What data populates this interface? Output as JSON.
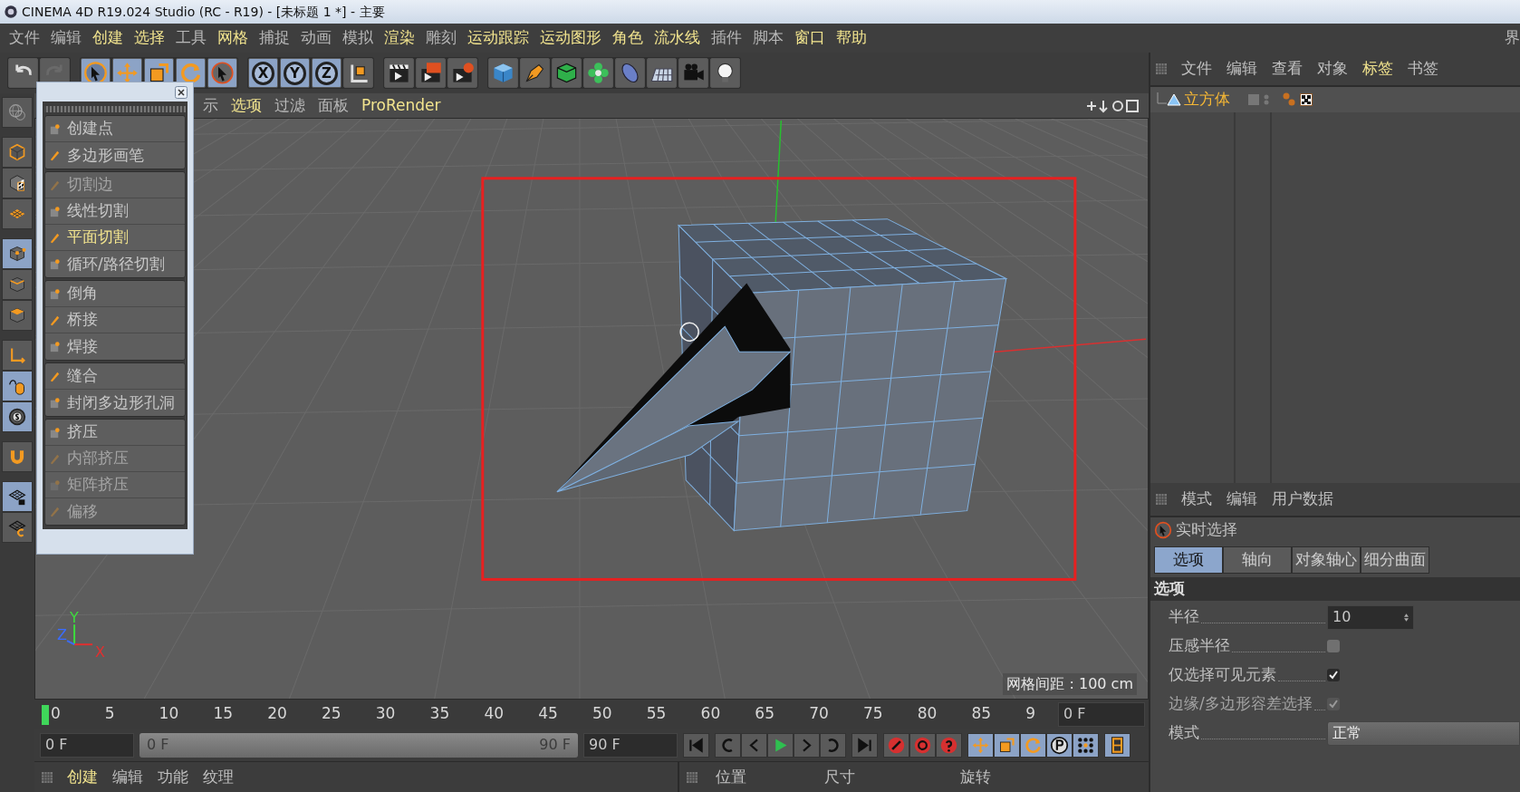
{
  "window": {
    "title": "CINEMA 4D R19.024 Studio (RC - R19) - [未标题 1 *] - 主要"
  },
  "menu": [
    {
      "label": "文件",
      "highlighted": false
    },
    {
      "label": "编辑",
      "highlighted": false
    },
    {
      "label": "创建",
      "highlighted": true
    },
    {
      "label": "选择",
      "highlighted": true
    },
    {
      "label": "工具",
      "highlighted": false
    },
    {
      "label": "网格",
      "highlighted": true
    },
    {
      "label": "捕捉",
      "highlighted": false
    },
    {
      "label": "动画",
      "highlighted": false
    },
    {
      "label": "模拟",
      "highlighted": false
    },
    {
      "label": "渲染",
      "highlighted": true
    },
    {
      "label": "雕刻",
      "highlighted": false
    },
    {
      "label": "运动跟踪",
      "highlighted": true
    },
    {
      "label": "运动图形",
      "highlighted": true
    },
    {
      "label": "角色",
      "highlighted": true
    },
    {
      "label": "流水线",
      "highlighted": true
    },
    {
      "label": "插件",
      "highlighted": false
    },
    {
      "label": "脚本",
      "highlighted": false
    },
    {
      "label": "窗口",
      "highlighted": true
    },
    {
      "label": "帮助",
      "highlighted": true
    }
  ],
  "menu_edge": "界",
  "toolbar": {
    "axis_locks": [
      "X",
      "Y",
      "Z"
    ]
  },
  "left_tools": [
    {
      "kind": "globe",
      "selected": false
    },
    {
      "kind": "cube",
      "selected": false
    },
    {
      "kind": "checker",
      "selected": false
    },
    {
      "kind": "grid",
      "selected": false
    },
    {
      "kind": "points",
      "selected": true
    },
    {
      "kind": "edges",
      "selected": false
    },
    {
      "kind": "polygons",
      "selected": false
    },
    {
      "kind": "axis",
      "selected": false
    },
    {
      "kind": "mouse",
      "selected": true
    },
    {
      "kind": "snap",
      "selected": true
    },
    {
      "kind": "magnet",
      "selected": false
    },
    {
      "kind": "gridlock",
      "selected": true
    },
    {
      "kind": "gridrotate",
      "selected": false
    }
  ],
  "viewport": {
    "menu": [
      {
        "label": "示",
        "highlighted": false
      },
      {
        "label": "选项",
        "highlighted": true
      },
      {
        "label": "过滤",
        "highlighted": false
      },
      {
        "label": "面板",
        "highlighted": false
      },
      {
        "label": "ProRender",
        "highlighted": true
      }
    ],
    "axes": [
      {
        "label": "Z",
        "color": "#3a6cff"
      },
      {
        "label": "Y",
        "color": "#3ddc3d"
      },
      {
        "label": "X",
        "color": "#e03030"
      }
    ],
    "grid_spacing": "网格间距 : 100 cm"
  },
  "tool_palette": {
    "groups": [
      {
        "items": [
          {
            "label": "创建点",
            "disabled": false,
            "highlighted": false
          },
          {
            "label": "多边形画笔",
            "disabled": false,
            "highlighted": false
          }
        ]
      },
      {
        "items": [
          {
            "label": "切割边",
            "disabled": true,
            "highlighted": false
          },
          {
            "label": "线性切割",
            "disabled": false,
            "highlighted": false
          },
          {
            "label": "平面切割",
            "disabled": false,
            "highlighted": true
          },
          {
            "label": "循环/路径切割",
            "disabled": false,
            "highlighted": false
          }
        ]
      },
      {
        "items": [
          {
            "label": "倒角",
            "disabled": false,
            "highlighted": false
          },
          {
            "label": "桥接",
            "disabled": false,
            "highlighted": false
          },
          {
            "label": "焊接",
            "disabled": false,
            "highlighted": false
          }
        ]
      },
      {
        "items": [
          {
            "label": "缝合",
            "disabled": false,
            "highlighted": false
          },
          {
            "label": "封闭多边形孔洞",
            "disabled": false,
            "highlighted": false
          }
        ]
      },
      {
        "items": [
          {
            "label": "挤压",
            "disabled": false,
            "highlighted": false
          },
          {
            "label": "内部挤压",
            "disabled": true,
            "highlighted": false
          },
          {
            "label": "矩阵挤压",
            "disabled": true,
            "highlighted": false
          },
          {
            "label": "偏移",
            "disabled": true,
            "highlighted": false
          }
        ]
      }
    ]
  },
  "object_manager": {
    "menu": [
      {
        "label": "文件",
        "highlighted": false
      },
      {
        "label": "编辑",
        "highlighted": false
      },
      {
        "label": "查看",
        "highlighted": false
      },
      {
        "label": "对象",
        "highlighted": false
      },
      {
        "label": "标签",
        "highlighted": true
      },
      {
        "label": "书签",
        "highlighted": false
      }
    ],
    "objects": [
      {
        "name": "立方体",
        "selected": true
      }
    ]
  },
  "attribute_manager": {
    "menu": [
      "模式",
      "编辑",
      "用户数据"
    ],
    "tool": "实时选择",
    "tabs": [
      {
        "label": "选项",
        "selected": true
      },
      {
        "label": "轴向",
        "selected": false
      },
      {
        "label": "对象轴心",
        "selected": false
      },
      {
        "label": "细分曲面",
        "selected": false
      }
    ],
    "section": "选项",
    "fields": [
      {
        "kind": "number",
        "label": "半径",
        "value": "10"
      },
      {
        "kind": "checkbox",
        "label": "压感半径",
        "checked": false,
        "disabled": false
      },
      {
        "kind": "checkbox",
        "label": "仅选择可见元素",
        "checked": true,
        "disabled": false
      },
      {
        "kind": "checkbox",
        "label": "边缘/多边形容差选择",
        "checked": true,
        "disabled": true
      },
      {
        "kind": "dropdown",
        "label": "模式",
        "value": "正常"
      }
    ]
  },
  "timeline": {
    "ticks": [
      "0",
      "5",
      "10",
      "15",
      "20",
      "25",
      "30",
      "35",
      "40",
      "45",
      "50",
      "55",
      "60",
      "65",
      "70",
      "75",
      "80",
      "85",
      "9"
    ],
    "current_frame": "0 F",
    "start": "0 F",
    "range": {
      "start": "0 F",
      "end": "90 F",
      "level": 1
    },
    "end": "90 F"
  },
  "material_manager": {
    "menu": [
      {
        "label": "创建",
        "highlighted": true
      },
      {
        "label": "编辑",
        "highlighted": false
      },
      {
        "label": "功能",
        "highlighted": false
      },
      {
        "label": "纹理",
        "highlighted": false
      }
    ]
  },
  "coordinates": {
    "columns": [
      "位置",
      "尺寸",
      "旋转"
    ]
  }
}
